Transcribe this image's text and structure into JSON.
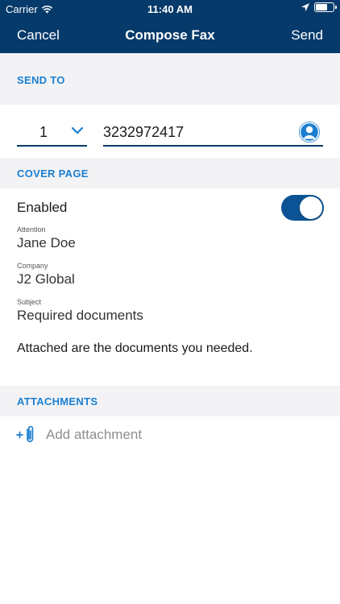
{
  "status_bar": {
    "carrier": "Carrier",
    "time": "11:40 AM"
  },
  "nav": {
    "cancel_label": "Cancel",
    "title": "Compose Fax",
    "send_label": "Send"
  },
  "send_to": {
    "section_label": "SEND TO",
    "line_selector": "1",
    "fax_number": "3232972417"
  },
  "cover_page": {
    "section_label": "COVER PAGE",
    "enabled_label": "Enabled",
    "enabled": true,
    "attention_label": "Attention",
    "attention_value": "Jane Doe",
    "company_label": "Company",
    "company_value": "J2 Global",
    "subject_label": "Subject",
    "subject_value": "Required documents",
    "message": "Attached are the documents you needed."
  },
  "attachments": {
    "section_label": "ATTACHMENTS",
    "add_label": "Add attachment"
  },
  "colors": {
    "header": "#063a6b",
    "accent": "#1b7fd1",
    "toggle_on": "#0b5394"
  }
}
